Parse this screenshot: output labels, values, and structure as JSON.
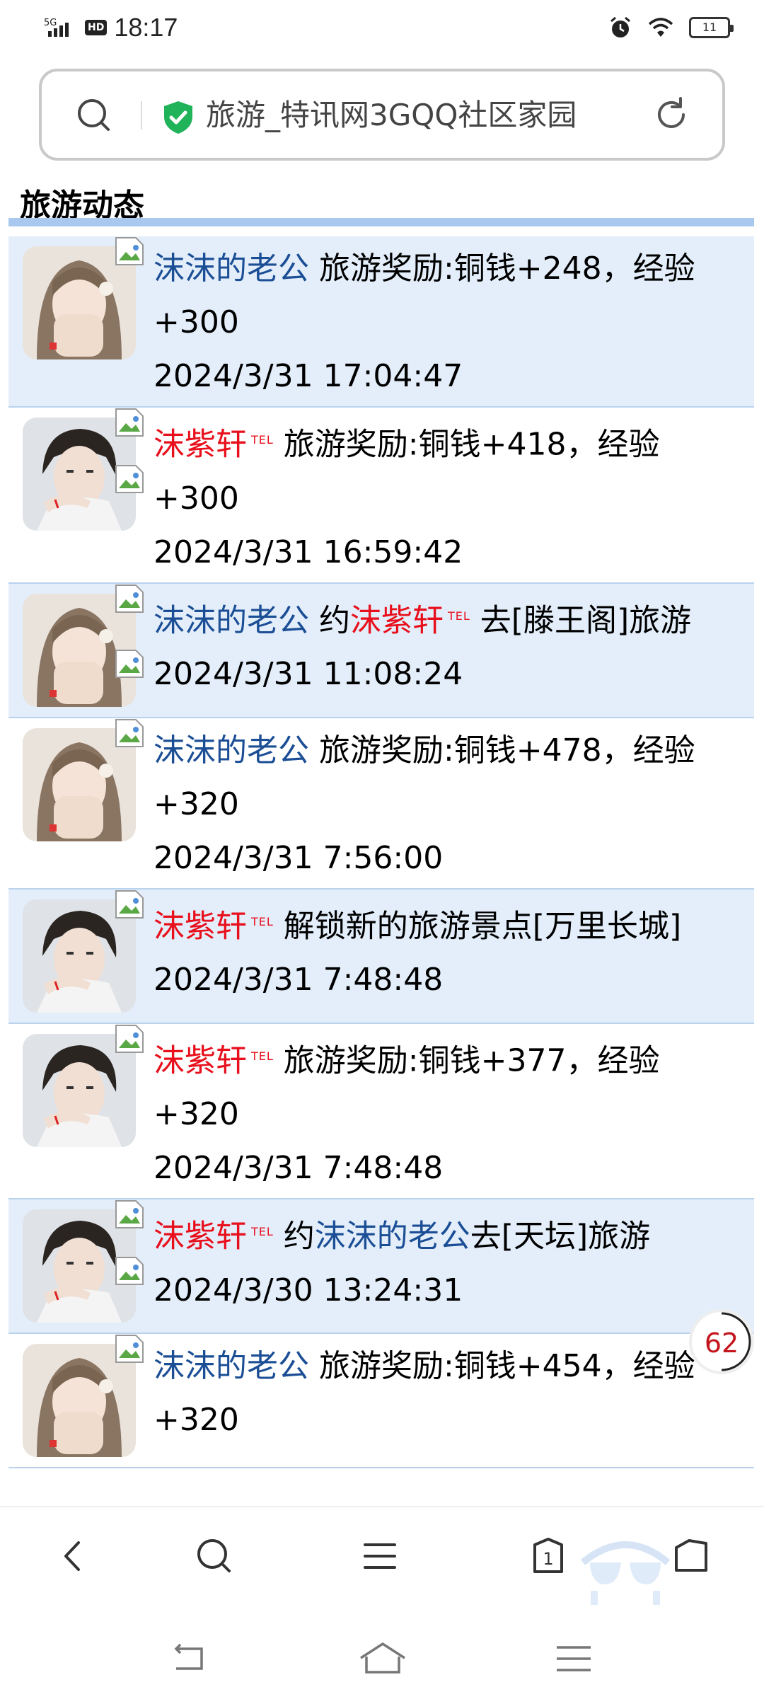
{
  "status_bar": {
    "network": "5G",
    "hd": "HD",
    "time": "18:17",
    "battery": "11"
  },
  "address_bar": {
    "title": "旅游_特讯网3GQQ社区家园"
  },
  "section": {
    "title": "旅游动态"
  },
  "feed": [
    {
      "alt": true,
      "avatar": "female",
      "segments": [
        {
          "text": "沫沫的老公",
          "style": "blue"
        },
        {
          "text": " 旅游奖励:铜钱+248，经验+300",
          "style": "plain"
        }
      ],
      "date": "2024/3/31 17:04:47"
    },
    {
      "alt": false,
      "avatar": "male",
      "segments": [
        {
          "text": "沫紫轩",
          "style": "red"
        },
        {
          "text": "TEL",
          "style": "tel"
        },
        {
          "text": "旅游奖励:铜钱+418，经验+300",
          "style": "plain"
        }
      ],
      "date": "2024/3/31 16:59:42"
    },
    {
      "alt": true,
      "avatar": "female",
      "segments": [
        {
          "text": "沫沫的老公",
          "style": "blue"
        },
        {
          "text": " 约",
          "style": "plain"
        },
        {
          "text": "沫紫轩",
          "style": "red"
        },
        {
          "text": "TEL",
          "style": "tel"
        },
        {
          "text": "去[滕王阁]旅游",
          "style": "plain"
        }
      ],
      "date": "2024/3/31 11:08:24"
    },
    {
      "alt": false,
      "avatar": "female",
      "segments": [
        {
          "text": "沫沫的老公",
          "style": "blue"
        },
        {
          "text": " 旅游奖励:铜钱+478，经验+320",
          "style": "plain"
        }
      ],
      "date": "2024/3/31 7:56:00"
    },
    {
      "alt": true,
      "avatar": "male",
      "segments": [
        {
          "text": "沫紫轩",
          "style": "red"
        },
        {
          "text": "TEL",
          "style": "tel"
        },
        {
          "text": "解锁新的旅游景点[万里长城]",
          "style": "plain"
        }
      ],
      "date": "2024/3/31 7:48:48"
    },
    {
      "alt": false,
      "avatar": "male",
      "segments": [
        {
          "text": "沫紫轩",
          "style": "red"
        },
        {
          "text": "TEL",
          "style": "tel"
        },
        {
          "text": "旅游奖励:铜钱+377，经验+320",
          "style": "plain"
        }
      ],
      "date": "2024/3/31 7:48:48"
    },
    {
      "alt": true,
      "avatar": "male",
      "segments": [
        {
          "text": "沫紫轩",
          "style": "red"
        },
        {
          "text": "TEL",
          "style": "tel"
        },
        {
          "text": "约",
          "style": "plain"
        },
        {
          "text": "沫沫的老公",
          "style": "blue"
        },
        {
          "text": "去[天坛]旅游",
          "style": "plain"
        }
      ],
      "date": "2024/3/30 13:24:31"
    },
    {
      "alt": false,
      "avatar": "female",
      "segments": [
        {
          "text": "沫沫的老公",
          "style": "blue"
        },
        {
          "text": " 旅游奖励:铜钱+454，经验+320",
          "style": "plain"
        }
      ],
      "date": ""
    }
  ],
  "float_counter": {
    "value": "62"
  },
  "bottom_nav": {
    "tab_count": "1"
  },
  "colors": {
    "name_blue": "#1b4e95",
    "name_red": "#e8101c",
    "row_alt": "#e3eefa",
    "section_line": "#a9c8ef",
    "shield_green": "#21b35a"
  },
  "icons": [
    "search-icon",
    "shield-check-icon",
    "refresh-icon",
    "back-icon",
    "menu-icon",
    "tabs-icon",
    "home-icon",
    "system-back-icon",
    "system-home-icon",
    "system-menu-icon"
  ]
}
